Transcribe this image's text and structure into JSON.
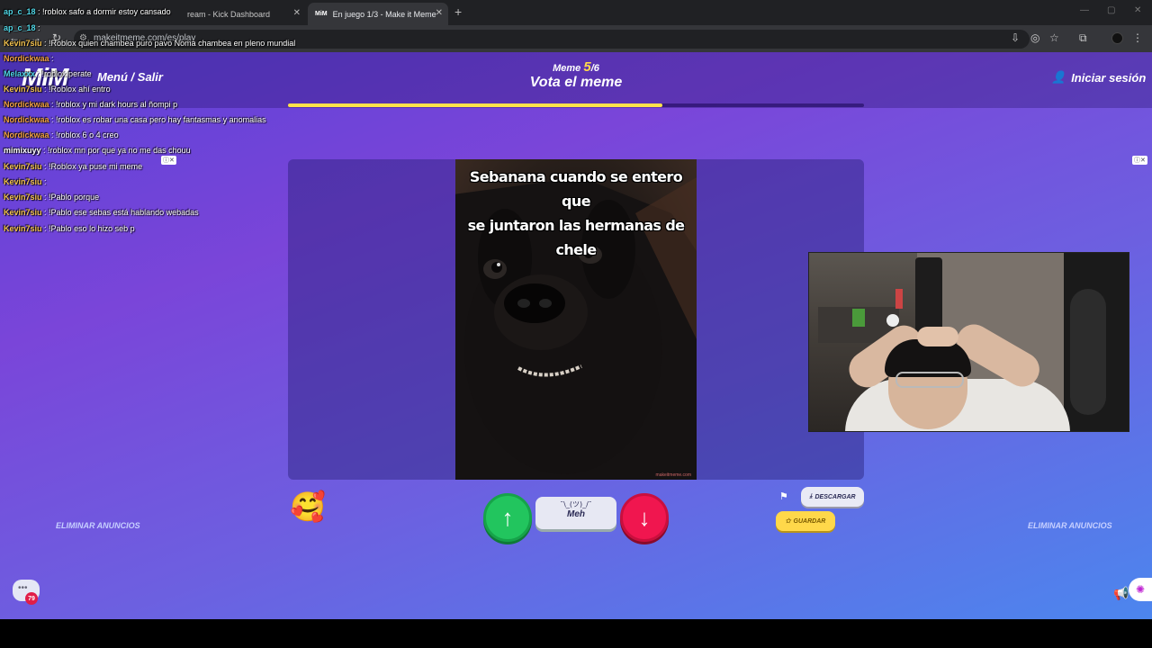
{
  "browser": {
    "tabs": [
      {
        "label": "ream - Kick Dashboard",
        "favicon": "",
        "active": false
      },
      {
        "label": "En juego 1/3 - Make it Meme",
        "favicon": "MiM",
        "active": true
      }
    ],
    "new_tab": "+",
    "url": "makeitmeme.com/es/play"
  },
  "header": {
    "logo": "MiM",
    "menu_label": "Menú / Salir",
    "round_prefix": "Meme",
    "round_current": "5",
    "round_total": "/6",
    "title": "Vota el meme",
    "login_label": "Iniciar sesión",
    "progress": 0.65
  },
  "meme": {
    "caption_line1": "Sebanana cuando se entero que",
    "caption_line2": "se juntaron las hermanas de chele",
    "watermark": "makeitmeme.com"
  },
  "vote": {
    "up_icon": "↑",
    "down_icon": "↓",
    "meh_face": "¯\\_(ツ)_/¯",
    "meh_label": "Meh"
  },
  "actions": {
    "flag_icon": "⚑",
    "download_label": "DESCARGAR",
    "save_label": "GUARDAR",
    "remove_ads": "ELIMINAR ANUNCIOS"
  },
  "chat_widget": {
    "badge": "79"
  },
  "stream_chat": [
    {
      "user": "ap_c_18",
      "msg": "!roblox safo a dormir estoy cansado",
      "color": "cyan"
    },
    {
      "user": "ap_c_18",
      "msg": "",
      "color": "cyan"
    },
    {
      "user": "Kevin7siu",
      "msg": "!Roblox quien chambea puro pavo Noma chambea en pleno mundial",
      "color": "yellow"
    },
    {
      "user": "Nordickwaa",
      "msg": "",
      "color": "orange"
    },
    {
      "user": "Melaxxx",
      "msg": "!roblox perate",
      "color": "cyan"
    },
    {
      "user": "Kevin7siu",
      "msg": "!Roblox ahí entro",
      "color": "yellow"
    },
    {
      "user": "Nordickwaa",
      "msg": "!roblox y mi dark hours al ñompi p",
      "color": "orange"
    },
    {
      "user": "Nordickwaa",
      "msg": "!roblox es robar una casa pero hay fantasmas y anomalias",
      "color": "orange"
    },
    {
      "user": "Nordickwaa",
      "msg": "!roblox 6 o 4 creo",
      "color": "orange"
    },
    {
      "user": "mimixuyy",
      "msg": "!roblox mn por que ya no me das chouu",
      "color": "white"
    },
    {
      "user": "Kevin7siu",
      "msg": "!Roblox ya puse mi meme",
      "color": "yellow"
    },
    {
      "user": "Kevin7siu",
      "msg": "",
      "color": "yellow"
    },
    {
      "user": "Kevin7siu",
      "msg": "!Pablo porque",
      "color": "yellow"
    },
    {
      "user": "Kevin7siu",
      "msg": "!Pablo ese sebas está hablando webadas",
      "color": "yellow"
    },
    {
      "user": "Kevin7siu",
      "msg": "!Pablo eso lo hizo seb p",
      "color": "yellow"
    }
  ],
  "colors": {
    "accent_yellow": "#ffe24a",
    "vote_up": "#22c55e",
    "vote_down": "#f0164f"
  }
}
